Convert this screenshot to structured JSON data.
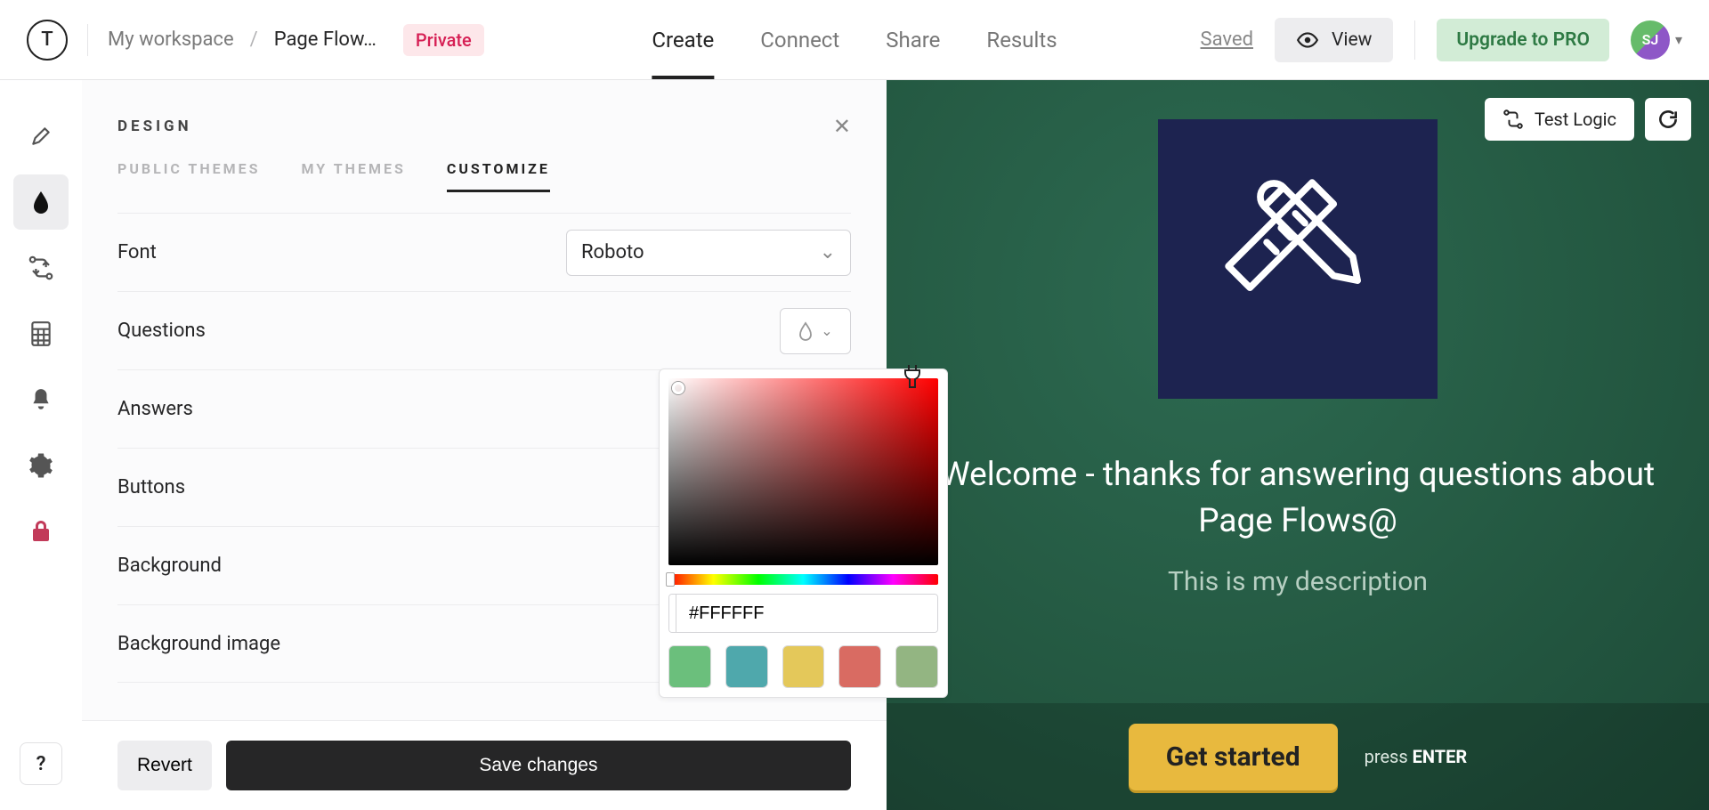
{
  "header": {
    "logo_letter": "T",
    "breadcrumb_workspace": "My workspace",
    "breadcrumb_current": "Page Flow…",
    "private_tag": "Private",
    "nav": [
      "Create",
      "Connect",
      "Share",
      "Results"
    ],
    "nav_active_index": 0
  },
  "right": {
    "saved": "Saved",
    "view": "View",
    "upgrade": "Upgrade to PRO",
    "avatar_initials": "SJ"
  },
  "sidebar": {
    "items": [
      "pencil",
      "drop",
      "logic",
      "calc",
      "bell",
      "gear",
      "lock"
    ],
    "active_index": 1
  },
  "design": {
    "title": "DESIGN",
    "tabs": [
      "PUBLIC THEMES",
      "MY THEMES",
      "CUSTOMIZE"
    ],
    "active_tab_index": 2,
    "rows": {
      "font_label": "Font",
      "font_value": "Roboto",
      "questions_label": "Questions",
      "answers_label": "Answers",
      "buttons_label": "Buttons",
      "background_label": "Background",
      "bg_image_label": "Background image"
    }
  },
  "picker": {
    "hex_value": "#FFFFFF",
    "swatches": [
      "#6bbf7c",
      "#4fa8ac",
      "#e4c85a",
      "#d96b62",
      "#93b582"
    ]
  },
  "footer": {
    "revert": "Revert",
    "save": "Save changes"
  },
  "preview": {
    "test_logic": "Test Logic",
    "welcome": "Welcome - thanks for answering questions about Page Flows@",
    "description": "This is my description",
    "cta": "Get started",
    "enter_prefix": "press ",
    "enter_key": "ENTER"
  }
}
